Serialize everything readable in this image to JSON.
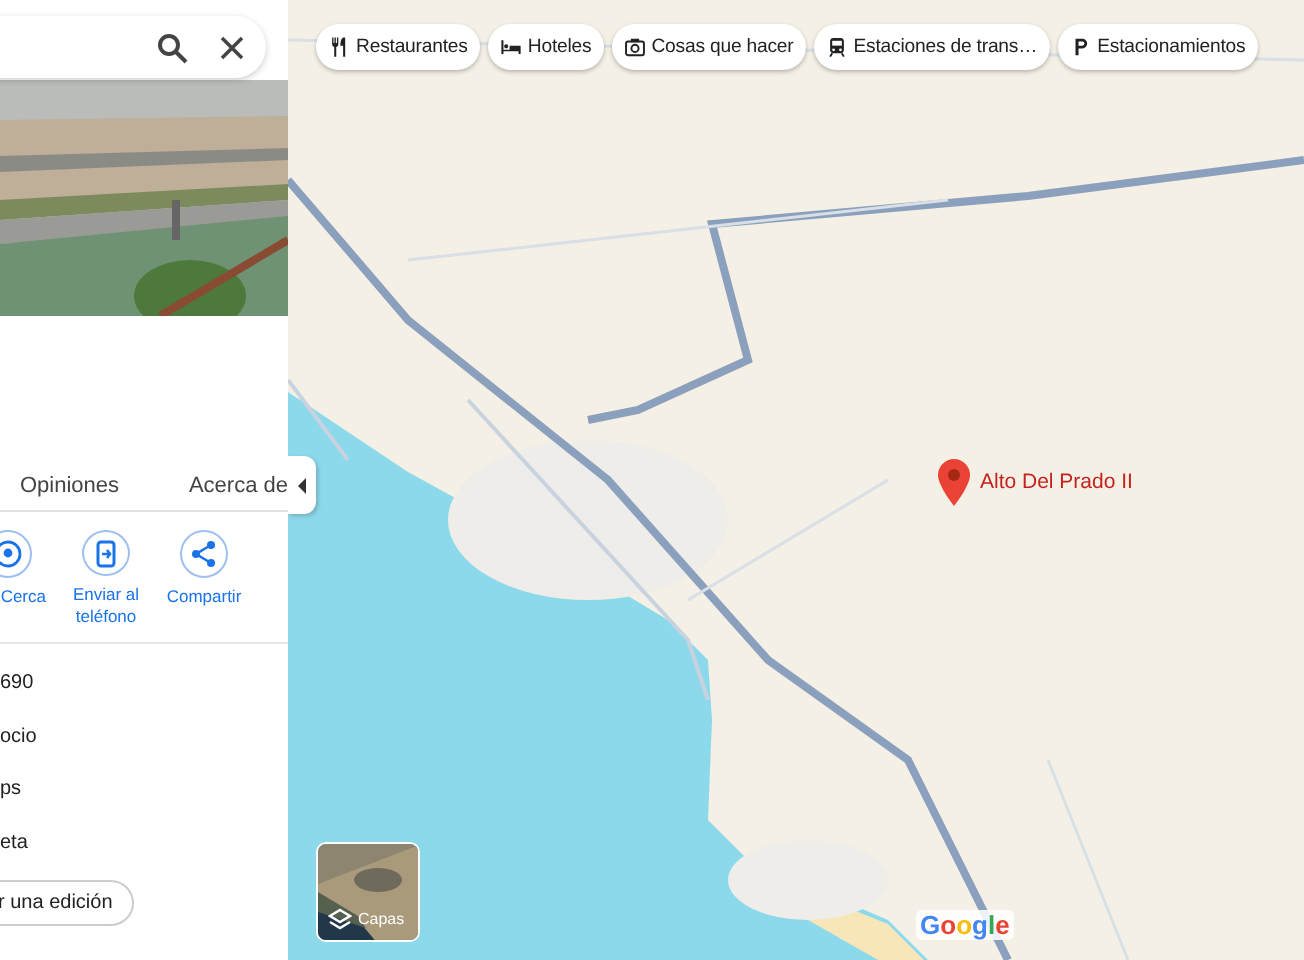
{
  "search": {
    "buttons": [
      {
        "kind": "search"
      },
      {
        "kind": "close"
      }
    ]
  },
  "place_photo": {
    "kind": "picture"
  },
  "tabs": [
    {
      "label": "Opiniones",
      "selected": false
    },
    {
      "label": "Acerca de",
      "selected": false
    }
  ],
  "actions": [
    {
      "kind": "nearby",
      "label": "Cerca"
    },
    {
      "kind": "phone",
      "label": "Enviar al teléfono"
    },
    {
      "kind": "share",
      "label": "Compartir"
    }
  ],
  "info_rows": [
    "690",
    "ocio",
    "ps",
    "eta"
  ],
  "edit_button": "r una edición",
  "category_chips": [
    {
      "kind": "restaurant",
      "label": "Restaurantes"
    },
    {
      "kind": "hotel",
      "label": "Hoteles"
    },
    {
      "kind": "camera",
      "label": "Cosas que hacer"
    },
    {
      "kind": "transit",
      "label": "Estaciones de trans…"
    },
    {
      "kind": "parking",
      "label": "Estacionamientos"
    }
  ],
  "map": {
    "kind": "picture",
    "marker": {
      "label": "Alto Del Prado II"
    },
    "logo": "Google"
  },
  "layers_button": {
    "label": "Capas"
  }
}
